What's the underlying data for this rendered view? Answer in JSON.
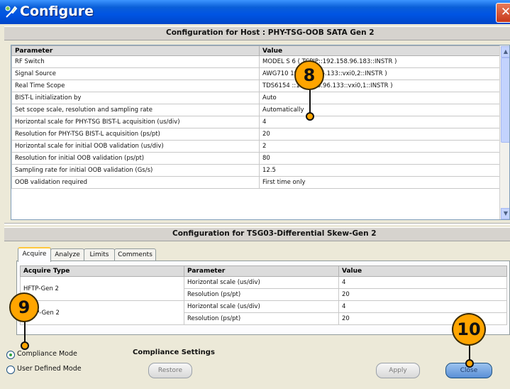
{
  "window": {
    "title": "Configure",
    "close_glyph": "✕"
  },
  "host_section": {
    "header": "Configuration for Host : PHY-TSG-OOB SATA Gen 2",
    "columns": [
      "Parameter",
      "Value"
    ],
    "rows": [
      {
        "param": "RF Switch",
        "value": "MODEL S 6 ( TCPIP::192.158.96.183::INSTR )"
      },
      {
        "param": "Signal Source",
        "value": "AWG710 192.158.96.133::vxi0,2::INSTR )"
      },
      {
        "param": "Real Time Scope",
        "value": "TDS6154 ::192.158.96.133::vxi0,1::INSTR )"
      },
      {
        "param": "BIST-L initialization by",
        "value": "Auto"
      },
      {
        "param": "Set scope scale, resolution and sampling rate",
        "value": "Automatically"
      },
      {
        "param": "Horizontal scale for PHY-TSG BIST-L acquisition (us/div)",
        "value": "4"
      },
      {
        "param": "Resolution for PHY-TSG BIST-L acquisition (ps/pt)",
        "value": "20"
      },
      {
        "param": "Horizontal scale for initial OOB validation (us/div)",
        "value": "2"
      },
      {
        "param": "Resolution for initial OOB validation (ps/pt)",
        "value": "80"
      },
      {
        "param": "Sampling rate for initial OOB validation (Gs/s)",
        "value": "12.5"
      },
      {
        "param": "OOB validation required",
        "value": "First time only"
      }
    ]
  },
  "test_section": {
    "header": "Configuration for TSG03-Differential Skew-Gen 2",
    "tabs": [
      "Acquire",
      "Analyze",
      "Limits",
      "Comments"
    ],
    "active_tab": "Acquire",
    "columns": [
      "Acquire Type",
      "Parameter",
      "Value"
    ],
    "groups": [
      {
        "type": "HFTP-Gen 2",
        "rows": [
          {
            "param": "Horizontal scale (us/div)",
            "value": "4"
          },
          {
            "param": "Resolution (ps/pt)",
            "value": "20"
          }
        ]
      },
      {
        "type": "MFTP-Gen 2",
        "rows": [
          {
            "param": "Horizontal scale (us/div)",
            "value": "4"
          },
          {
            "param": "Resolution (ps/pt)",
            "value": "20"
          }
        ]
      }
    ]
  },
  "bottom": {
    "compliance_mode": "Compliance Mode",
    "user_defined_mode": "User Defined Mode",
    "selected_mode": "Compliance Mode",
    "compliance_settings": "Compliance Settings",
    "restore": "Restore",
    "apply": "Apply",
    "close": "Close"
  },
  "callouts": {
    "c8": "8",
    "c9": "9",
    "c10": "10"
  },
  "colors": {
    "titlebar": "#0054e3",
    "callout": "#ffa500",
    "accent_tab": "#ffc83c"
  }
}
